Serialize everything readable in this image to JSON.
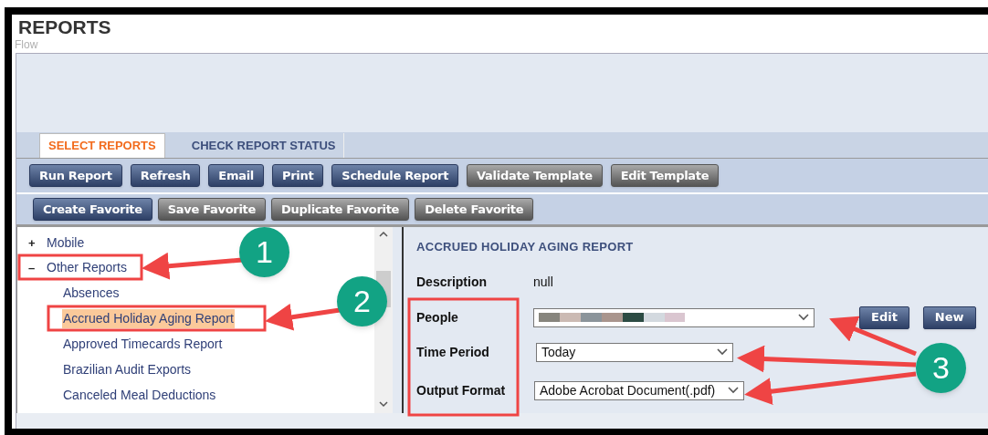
{
  "page_title": "REPORTS",
  "ghost_label": "Flow",
  "tabs": [
    {
      "label": "SELECT REPORTS",
      "selected": true
    },
    {
      "label": "CHECK REPORT STATUS",
      "selected": false
    }
  ],
  "toolbar_rows": [
    [
      {
        "label": "Run Report",
        "disabled": false
      },
      {
        "label": "Refresh",
        "disabled": false
      },
      {
        "label": "Email",
        "disabled": false
      },
      {
        "label": "Print",
        "disabled": false
      },
      {
        "label": "Schedule Report",
        "disabled": false
      },
      {
        "label": "Validate Template",
        "disabled": true
      },
      {
        "label": "Edit Template",
        "disabled": true
      }
    ],
    [
      {
        "label": "Create Favorite",
        "disabled": false
      },
      {
        "label": "Save Favorite",
        "disabled": true
      },
      {
        "label": "Duplicate Favorite",
        "disabled": true
      },
      {
        "label": "Delete Favorite",
        "disabled": true
      }
    ]
  ],
  "tree": [
    {
      "label": "Mobile",
      "toggle": "+"
    },
    {
      "label": "Other Reports",
      "toggle": "–",
      "children": [
        {
          "label": "Absences",
          "selected": false
        },
        {
          "label": "Accrued Holiday Aging Report",
          "selected": true
        },
        {
          "label": "Approved Timecards Report",
          "selected": false
        },
        {
          "label": "Brazilian Audit Exports",
          "selected": false
        },
        {
          "label": "Canceled Meal Deductions",
          "selected": false
        }
      ]
    }
  ],
  "detail": {
    "title": "ACCRUED HOLIDAY AGING REPORT",
    "description_label": "Description",
    "description": "null",
    "fields": [
      {
        "label": "People",
        "kind": "redacted"
      },
      {
        "label": "Time Period",
        "kind": "select",
        "value": "Today"
      },
      {
        "label": "Output Format",
        "kind": "select",
        "value": "Adobe Acrobat Document(.pdf)"
      }
    ],
    "people_buttons": [
      "Edit",
      "New"
    ]
  },
  "callouts": [
    "1",
    "2",
    "3"
  ]
}
